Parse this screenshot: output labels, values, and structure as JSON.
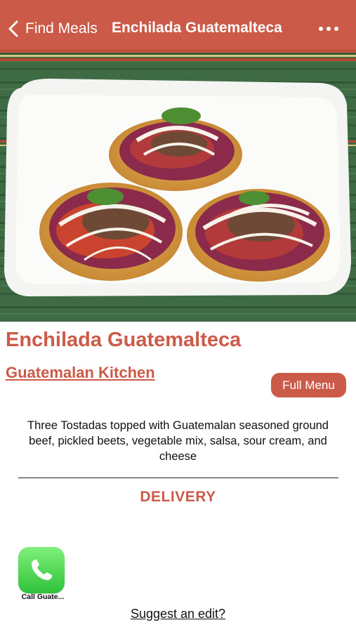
{
  "nav": {
    "back_label": "Find Meals",
    "title": "Enchilada Guatemalteca",
    "more_icon": "ellipsis-icon",
    "back_icon": "chevron-left-icon"
  },
  "hero": {
    "image_subject": "three tostadas on white plate"
  },
  "dish": {
    "name": "Enchilada Guatemalteca",
    "restaurant": "Guatemalan Kitchen",
    "full_menu_label": "Full Menu",
    "description": "Three Tostadas topped with Guatemalan seasoned ground beef, pickled beets, vegetable mix, salsa, sour cream, and cheese"
  },
  "service": {
    "type_label": "DELIVERY"
  },
  "call": {
    "label": "Call Guate...",
    "icon": "phone-icon"
  },
  "suggest_edit_label": "Suggest an edit?",
  "colors": {
    "accent": "#cc5a48",
    "call_green": "#3fcf45"
  }
}
